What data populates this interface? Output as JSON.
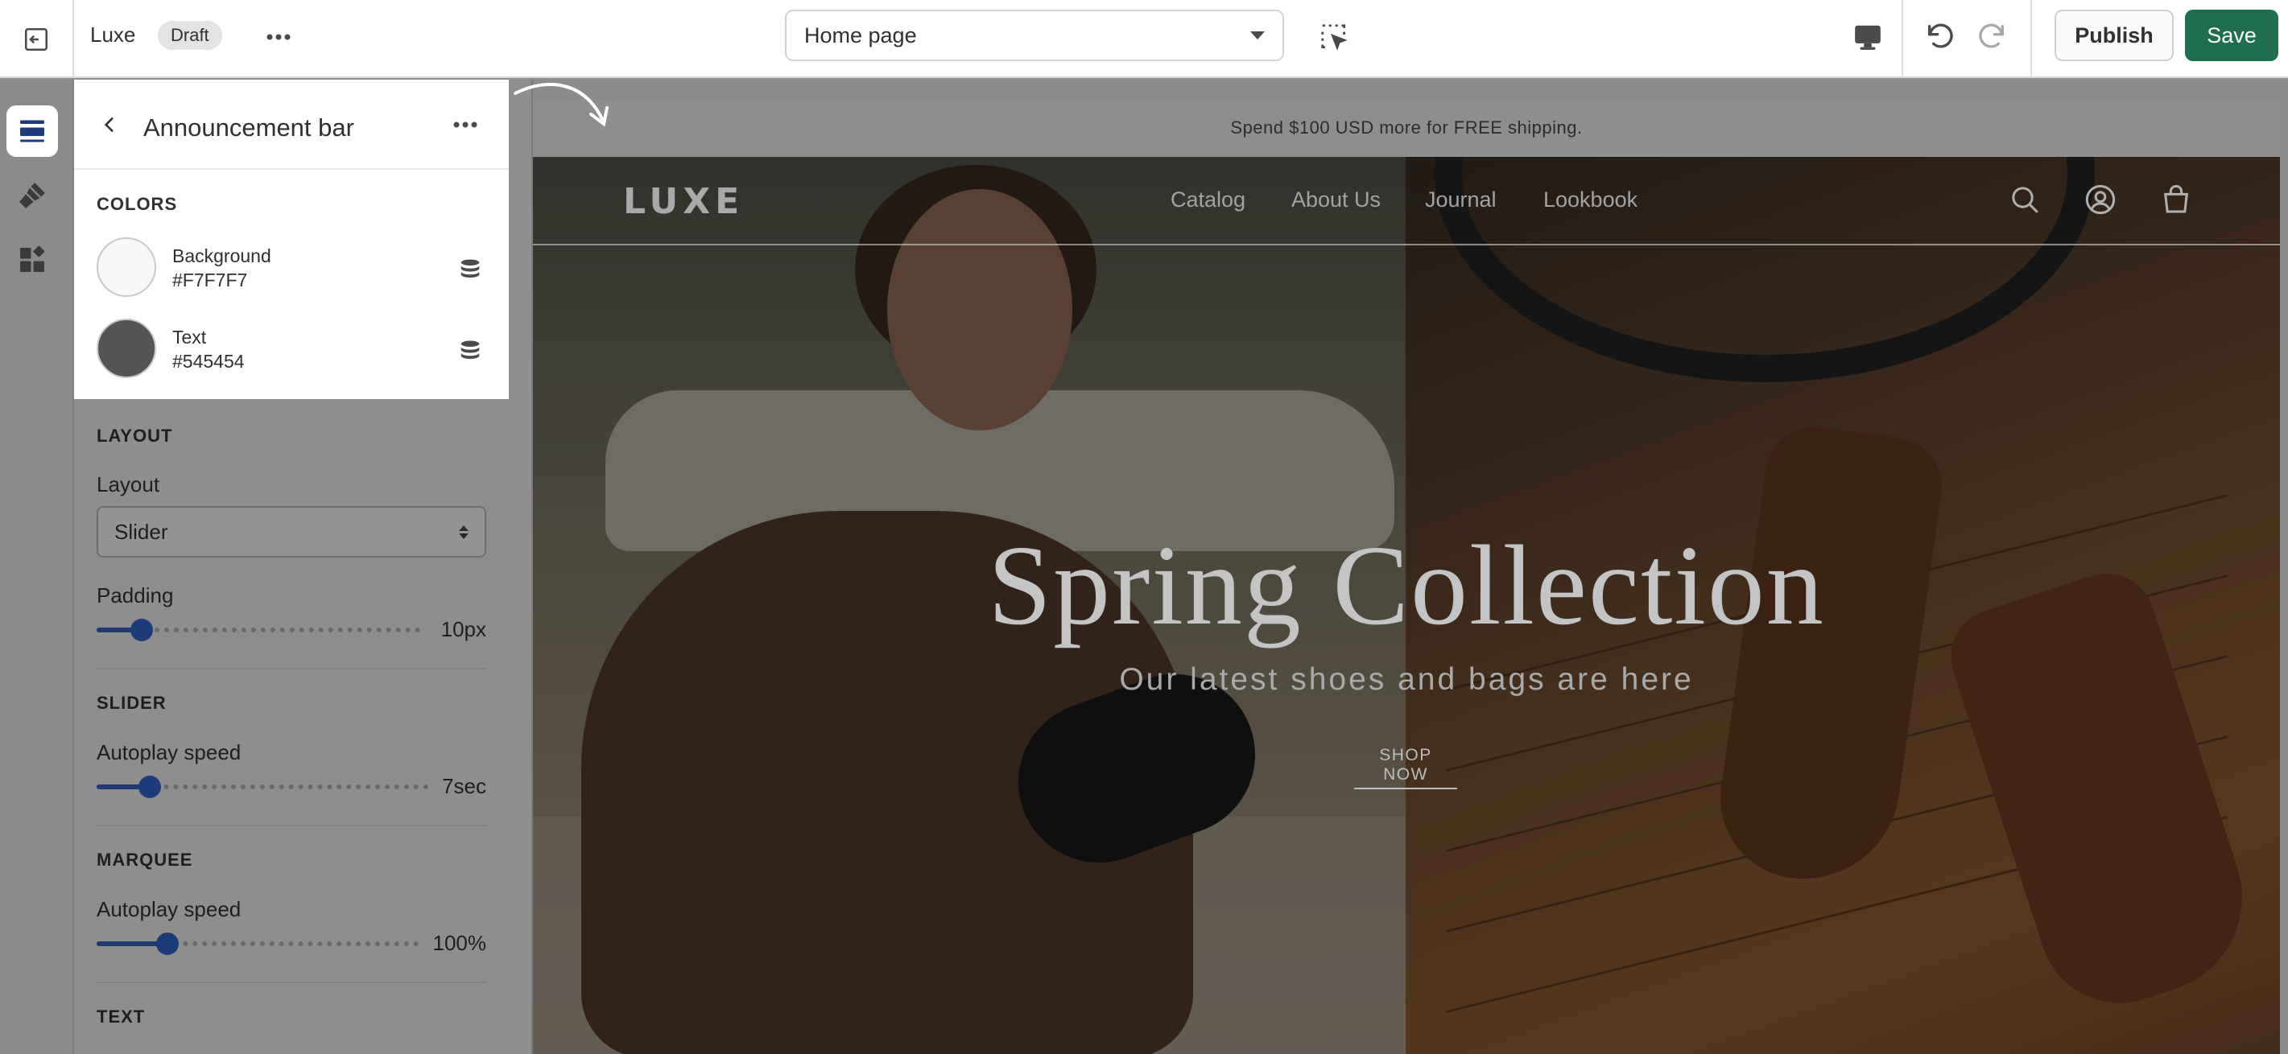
{
  "topbar": {
    "store_name": "Luxe",
    "status_badge": "Draft",
    "page_selector": "Home page",
    "publish_label": "Publish",
    "save_label": "Save"
  },
  "panel": {
    "title": "Announcement bar",
    "colors": {
      "section_title": "COLORS",
      "background_label": "Background",
      "background_hex": "#F7F7F7",
      "text_label": "Text",
      "text_hex": "#545454"
    },
    "layout": {
      "section_title": "LAYOUT",
      "layout_label": "Layout",
      "layout_value": "Slider",
      "padding_label": "Padding",
      "padding_value": "10px",
      "padding_fraction": 0.14
    },
    "slider": {
      "section_title": "SLIDER",
      "autoplay_label": "Autoplay speed",
      "autoplay_value": "7sec",
      "autoplay_fraction": 0.16
    },
    "marquee": {
      "section_title": "MARQUEE",
      "autoplay_label": "Autoplay speed",
      "autoplay_value": "100%",
      "autoplay_fraction": 0.22
    },
    "text_section_title": "TEXT"
  },
  "preview": {
    "announcement": "Spend $100 USD more for FREE shipping.",
    "brand": "LUXE",
    "nav": [
      "Catalog",
      "About Us",
      "Journal",
      "Lookbook"
    ],
    "hero_title": "Spring Collection",
    "hero_subtitle": "Our latest shoes and bags are here",
    "hero_cta": "SHOP NOW"
  },
  "colors": {
    "accent_green": "#1F6E4D",
    "slider_blue": "#1D3B7A",
    "swatch_background": "#F7F7F7",
    "swatch_text": "#545454"
  },
  "icons": {
    "exit": "exit-icon",
    "more": "more-horizontal-icon",
    "inspect": "select-element-icon",
    "device": "desktop-icon",
    "undo": "undo-icon",
    "redo": "redo-icon",
    "sections": "sections-icon",
    "theme_settings": "paint-brush-icon",
    "apps": "apps-icon",
    "back": "chevron-left-icon",
    "database": "database-icon",
    "search": "search-icon",
    "account": "account-icon",
    "cart": "cart-icon"
  }
}
